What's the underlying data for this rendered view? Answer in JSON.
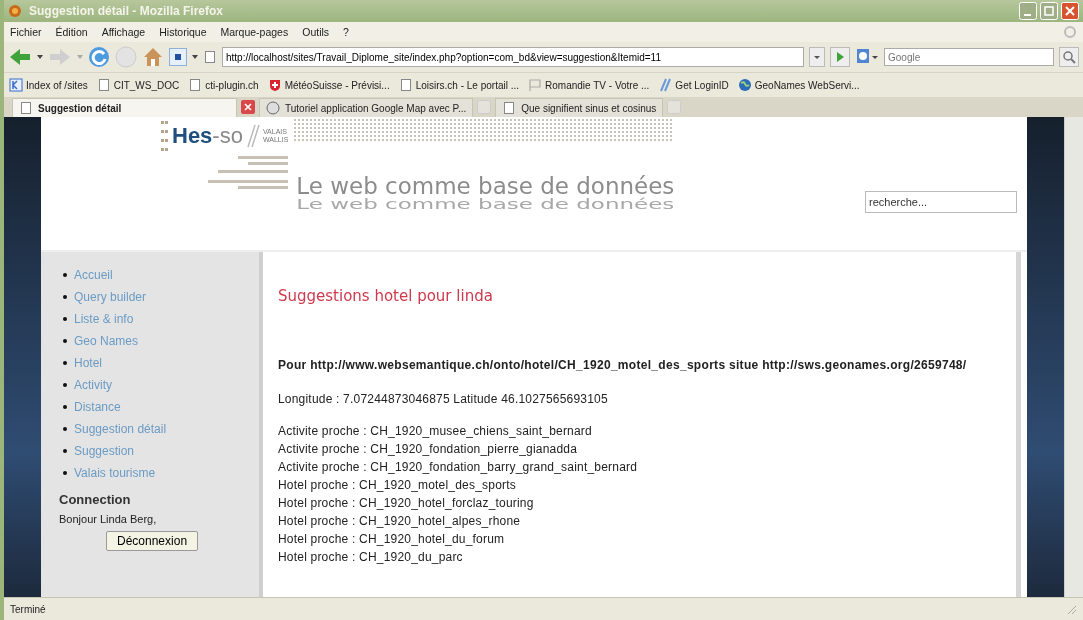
{
  "window": {
    "title": "Suggestion détail - Mozilla Firefox"
  },
  "menu": [
    "Fichier",
    "Édition",
    "Affichage",
    "Historique",
    "Marque-pages",
    "Outils",
    "?"
  ],
  "toolbar": {
    "url": "http://localhost/sites/Travail_Diplome_site/index.php?option=com_bd&view=suggestion&Itemid=11",
    "search_placeholder": "Google"
  },
  "bookmarks": [
    {
      "label": "Index of /sites",
      "kind": "index"
    },
    {
      "label": "CIT_WS_DOC",
      "kind": "page"
    },
    {
      "label": "cti-plugin.ch",
      "kind": "page"
    },
    {
      "label": "MétéoSuisse - Prévisi...",
      "kind": "shield"
    },
    {
      "label": "Loisirs.ch - Le portail ...",
      "kind": "page"
    },
    {
      "label": "Romandie TV - Votre ...",
      "kind": "flag"
    },
    {
      "label": "Get LoginID",
      "kind": "slash"
    },
    {
      "label": "GeoNames WebServi...",
      "kind": "globe"
    }
  ],
  "tabs": [
    {
      "label": "Suggestion détail",
      "selected": true,
      "kind": "page"
    },
    {
      "label": "Tutoriel application Google Map avec P...",
      "selected": false,
      "kind": "face"
    },
    {
      "label": "Que signifient sinus et cosinus",
      "selected": false,
      "kind": "page"
    }
  ],
  "site": {
    "logo": {
      "name": "Hes",
      "suffix": "-so",
      "region_1": "VALAIS",
      "region_2": "WALLIS"
    },
    "title": "Le web comme base de données",
    "title_reflection": "Le web comme base de données",
    "search": {
      "placeholder": "recherche..."
    }
  },
  "sidebar": {
    "items": [
      {
        "label": "Accueil"
      },
      {
        "label": "Query builder"
      },
      {
        "label": "Liste & info"
      },
      {
        "label": "Geo Names"
      },
      {
        "label": "Hotel"
      },
      {
        "label": "Activity"
      },
      {
        "label": "Distance"
      },
      {
        "label": "Suggestion détail"
      },
      {
        "label": "Suggestion"
      },
      {
        "label": "Valais tourisme"
      }
    ],
    "connection": {
      "heading": "Connection",
      "greeting": "Bonjour Linda Berg,",
      "button": "Déconnexion"
    }
  },
  "main": {
    "heading": "Suggestions hotel pour linda",
    "subject": "Pour http://www.websemantique.ch/onto/hotel/CH_1920_motel_des_sports situe http://sws.geonames.org/2659748/",
    "coordinates": "Longitude : 7.07244873046875 Latitude 46.1027565693105",
    "results": [
      {
        "label": "Activite proche :",
        "value": "CH_1920_musee_chiens_saint_bernard"
      },
      {
        "label": "Activite proche :",
        "value": "CH_1920_fondation_pierre_gianadda"
      },
      {
        "label": "Activite proche :",
        "value": "CH_1920_fondation_barry_grand_saint_bernard"
      },
      {
        "label": "Hotel proche :",
        "value": "CH_1920_motel_des_sports"
      },
      {
        "label": "Hotel proche :",
        "value": "CH_1920_hotel_forclaz_touring"
      },
      {
        "label": "Hotel proche :",
        "value": "CH_1920_hotel_alpes_rhone"
      },
      {
        "label": "Hotel proche :",
        "value": "CH_1920_hotel_du_forum"
      },
      {
        "label": "Hotel proche :",
        "value": "CH_1920_du_parc"
      }
    ]
  },
  "status_bar": {
    "text": "Terminé"
  }
}
